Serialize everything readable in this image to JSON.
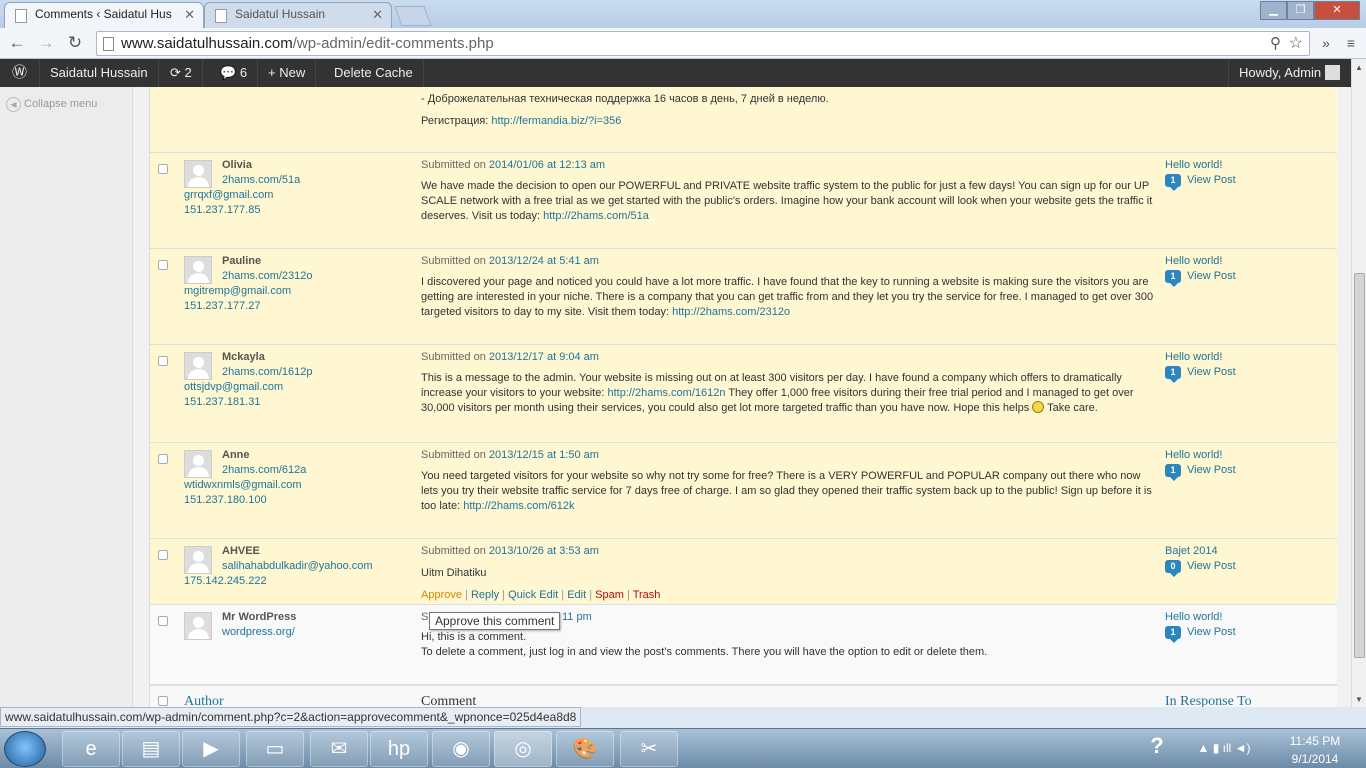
{
  "browser": {
    "tabs": [
      {
        "title": "Comments ‹ Saidatul Hus",
        "active": true
      },
      {
        "title": "Saidatul Hussain",
        "active": false
      }
    ],
    "url_domain": "www.saidatulhussain.com",
    "url_path": "/wp-admin/edit-comments.php",
    "status_url": "www.saidatulhussain.com/wp-admin/comment.php?c=2&action=approvecomment&_wpnonce=025d4ea8d8"
  },
  "adminbar": {
    "site_name": "Saidatul Hussain",
    "updates_count": "2",
    "comments_count": "6",
    "new_label": "New",
    "delete_cache_label": "Delete Cache",
    "greeting": "Howdy, Admin"
  },
  "sidebar": {
    "collapse_label": "Collapse menu"
  },
  "top_partial": {
    "line1": "- Доброжелательная техническая поддержка 16 часов в день, 7 дней в неделю.",
    "reg_label": "Регистрация: ",
    "reg_link": "http://fermandia.biz/?i=356"
  },
  "comments": [
    {
      "author": "Olivia",
      "site": "2hams.com/51a",
      "email": "grrqxf@gmail.com",
      "ip": "151.237.177.85",
      "submitted_prefix": "Submitted on ",
      "date": "2014/01/06 at 12:13 am",
      "text": "We have made the decision to open our POWERFUL and PRIVATE website traffic system to the public for just a few days! You can sign up for our UP SCALE network with a free trial as we get started with the public's orders. Imagine how your bank account will look when your website gets the traffic it deserves. Visit us today: ",
      "link": "http://2hams.com/51a",
      "post": "Hello world!",
      "post_count": "1",
      "view_post": "View Post"
    },
    {
      "author": "Pauline",
      "site": "2hams.com/2312o",
      "email": "mgitremp@gmail.com",
      "ip": "151.237.177.27",
      "submitted_prefix": "Submitted on ",
      "date": "2013/12/24 at 5:41 am",
      "text": "I discovered your page and noticed you could have a lot more traffic. I have found that the key to running a website is making sure the visitors you are getting are interested in your niche. There is a company that you can get traffic from and they let you try the service for free. I managed to get over 300 targeted visitors to day to my site. Visit them today: ",
      "link": "http://2hams.com/2312o",
      "post": "Hello world!",
      "post_count": "1",
      "view_post": "View Post"
    },
    {
      "author": "Mckayla",
      "site": "2hams.com/1612p",
      "email": "ottsjdvp@gmail.com",
      "ip": "151.237.181.31",
      "submitted_prefix": "Submitted on ",
      "date": "2013/12/17 at 9:04 am",
      "text_before": "This is a message to the admin. Your website is missing out on at least 300 visitors per day. I have found a company which offers to dramatically increase your visitors to your website: ",
      "link": "http://2hams.com/1612n",
      "text_after": " They offer 1,000 free visitors during their free trial period and I managed to get over 30,000 visitors per month using their services, you could also get lot more targeted traffic than you have now. Hope this helps ",
      "text_end": " Take care.",
      "post": "Hello world!",
      "post_count": "1",
      "view_post": "View Post"
    },
    {
      "author": "Anne",
      "site": "2hams.com/612a",
      "email": "wtidwxnmls@gmail.com",
      "ip": "151.237.180.100",
      "submitted_prefix": "Submitted on ",
      "date": "2013/12/15 at 1:50 am",
      "text": "You need targeted visitors for your website so why not try some for free? There is a VERY POWERFUL and POPULAR company out there who now lets you try their website traffic service for 7 days free of charge. I am so glad they opened their traffic system back up to the public! Sign up before it is too late: ",
      "link": "http://2hams.com/612k",
      "post": "Hello world!",
      "post_count": "1",
      "view_post": "View Post"
    },
    {
      "author": "AHVEE",
      "email": "salihahabdulkadir@yahoo.com",
      "ip": "175.142.245.222",
      "submitted_prefix": "Submitted on ",
      "date": "2013/10/26 at 3:53 am",
      "text": "Uitm Dihatiku",
      "post": "Bajet 2014",
      "post_count": "0",
      "view_post": "View Post",
      "actions": {
        "approve": "Approve",
        "reply": "Reply",
        "quick_edit": "Quick Edit",
        "edit": "Edit",
        "spam": "Spam",
        "trash": "Trash"
      }
    },
    {
      "author": "Mr WordPress",
      "site": "wordpress.org/",
      "submitted_visible_start": "S",
      "submitted_visible_end": "11 pm",
      "text_line1": "Hi, this is a comment.",
      "text_line2": "To delete a comment, just log in and view the post's comments. There you will have the option to edit or delete them.",
      "post": "Hello world!",
      "post_count": "1",
      "view_post": "View Post"
    }
  ],
  "tooltip": "Approve this comment",
  "table_footer": {
    "author": "Author",
    "comment": "Comment",
    "in_response_to": "In Response To"
  },
  "taskbar": {
    "time": "11:45 PM",
    "date": "9/1/2014"
  }
}
